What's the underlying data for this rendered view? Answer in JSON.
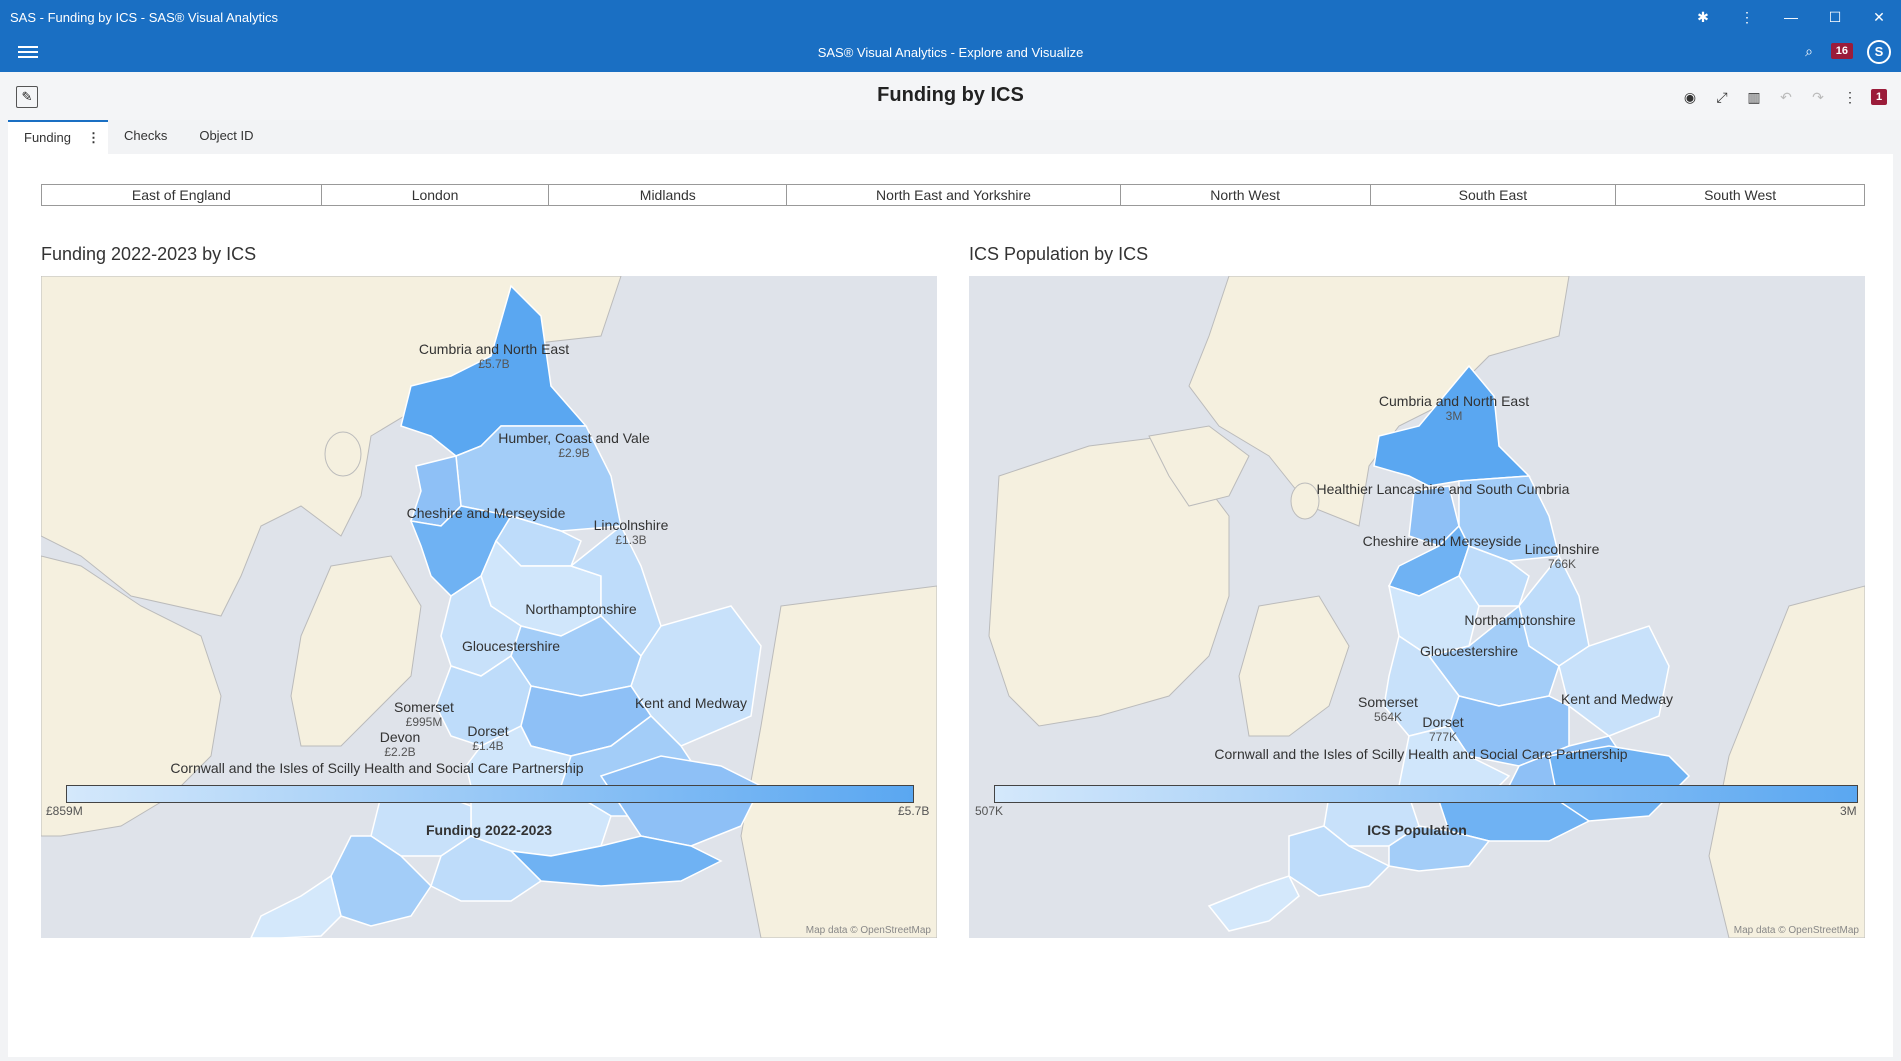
{
  "window": {
    "title": "SAS - Funding by ICS - SAS® Visual Analytics"
  },
  "app": {
    "title": "SAS® Visual Analytics - Explore and Visualize",
    "notifications": "16",
    "avatar": "S"
  },
  "report": {
    "title": "Funding by ICS",
    "alerts": "1"
  },
  "tabs": [
    {
      "label": "Funding"
    },
    {
      "label": "Checks"
    },
    {
      "label": "Object ID"
    }
  ],
  "regions": [
    "East of England",
    "London",
    "Midlands",
    "North East and Yorkshire",
    "North West",
    "South East",
    "South West"
  ],
  "maps": [
    {
      "title": "Funding 2022-2023 by ICS",
      "labels": [
        {
          "name": "Cumbria and North East",
          "value": "£5.7B"
        },
        {
          "name": "Humber, Coast and Vale",
          "value": "£2.9B"
        },
        {
          "name": "Cheshire and Merseyside",
          "value": ""
        },
        {
          "name": "Lincolnshire",
          "value": "£1.3B"
        },
        {
          "name": "Northamptonshire",
          "value": ""
        },
        {
          "name": "Gloucestershire",
          "value": ""
        },
        {
          "name": "Kent and Medway",
          "value": ""
        },
        {
          "name": "Somerset",
          "value": "£995M"
        },
        {
          "name": "Devon",
          "value": "£2.2B"
        },
        {
          "name": "Dorset",
          "value": "£1.4B"
        },
        {
          "name": "Cornwall and the Isles of Scilly Health and Social Care Partnership",
          "value": ""
        }
      ],
      "attribution": "Map data © OpenStreetMap",
      "legend": {
        "title": "Funding 2022-2023",
        "min": "£859M",
        "max": "£5.7B"
      }
    },
    {
      "title": "ICS Population by ICS",
      "labels": [
        {
          "name": "Cumbria and North East",
          "value": "3M"
        },
        {
          "name": "Healthier Lancashire and South Cumbria",
          "value": ""
        },
        {
          "name": "Cheshire and Merseyside",
          "value": ""
        },
        {
          "name": "Lincolnshire",
          "value": "766K"
        },
        {
          "name": "Northamptonshire",
          "value": ""
        },
        {
          "name": "Gloucestershire",
          "value": ""
        },
        {
          "name": "Kent and Medway",
          "value": ""
        },
        {
          "name": "Somerset",
          "value": "564K"
        },
        {
          "name": "Dorset",
          "value": "777K"
        },
        {
          "name": "Cornwall and the Isles of Scilly Health and Social Care Partnership",
          "value": ""
        }
      ],
      "attribution": "Map data © OpenStreetMap",
      "legend": {
        "title": "ICS Population",
        "min": "507K",
        "max": "3M"
      }
    }
  ]
}
